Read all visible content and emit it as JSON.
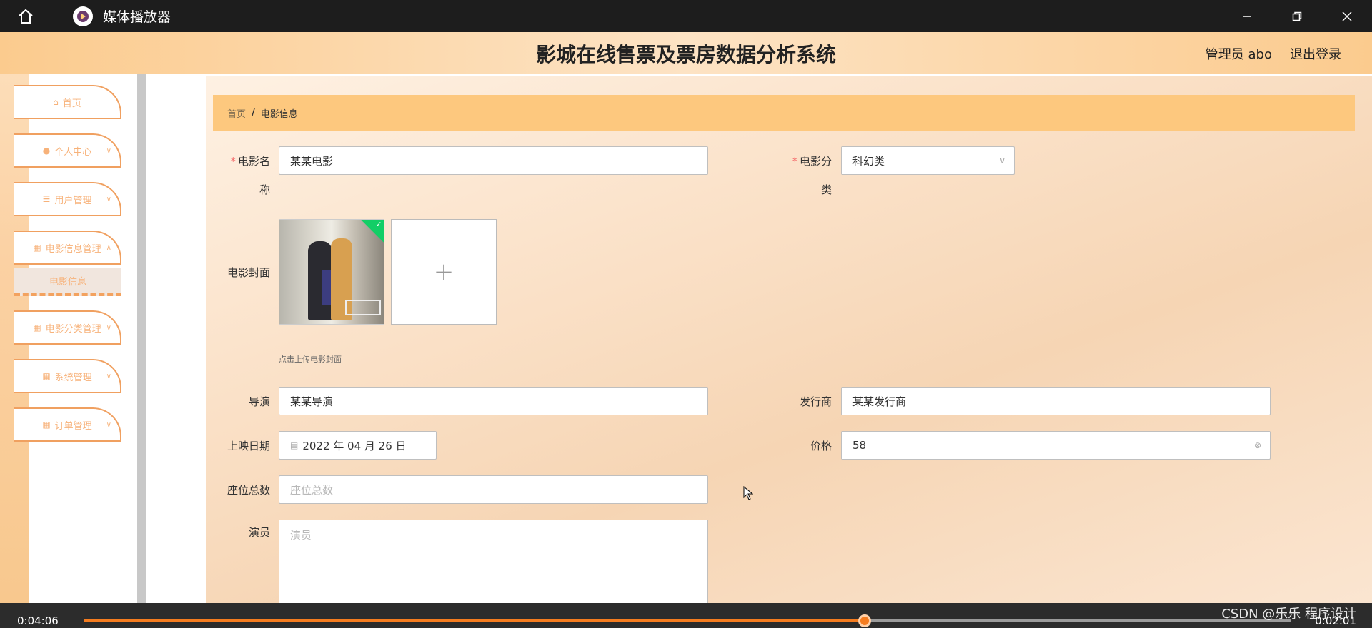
{
  "player": {
    "title": "媒体播放器",
    "time_elapsed": "0:04:06",
    "time_remaining": "0:02:01",
    "progress": 0.647,
    "watermark": "CSDN @乐乐 程序设计",
    "accent": "#f57c1f"
  },
  "header": {
    "title": "影城在线售票及票房数据分析系统",
    "admin": "管理员 abo",
    "logout": "退出登录"
  },
  "sidebar": {
    "items": [
      {
        "icon": "home-icon",
        "label": "首页"
      },
      {
        "icon": "user-icon",
        "label": "个人中心"
      },
      {
        "icon": "sliders-icon",
        "label": "用户管理"
      },
      {
        "icon": "grid-icon",
        "label": "电影信息管理"
      },
      {
        "icon": "grid-icon",
        "label": "电影分类管理"
      },
      {
        "icon": "grid-icon",
        "label": "系统管理"
      },
      {
        "icon": "grid-icon",
        "label": "订单管理"
      }
    ],
    "submenu_active": "电影信息"
  },
  "breadcrumb": {
    "home": "首页",
    "separator": "/",
    "current": "电影信息"
  },
  "form": {
    "movie_name": {
      "label_1": "电影名",
      "label_2": "称",
      "value": "某某电影"
    },
    "category": {
      "label_1": "电影分",
      "label_2": "类",
      "value": "科幻类"
    },
    "cover": {
      "label": "电影封面",
      "hint": "点击上传电影封面",
      "add": "+"
    },
    "director": {
      "label": "导演",
      "value": "某某导演"
    },
    "publisher": {
      "label": "发行商",
      "value": "某某发行商"
    },
    "release_date": {
      "label": "上映日期",
      "value": "2022 年 04 月 26 日"
    },
    "price": {
      "label": "价格",
      "value": "58"
    },
    "seats": {
      "label": "座位总数",
      "placeholder": "座位总数"
    },
    "actors": {
      "label": "演员",
      "placeholder": "演员"
    },
    "required_mark": "*"
  }
}
